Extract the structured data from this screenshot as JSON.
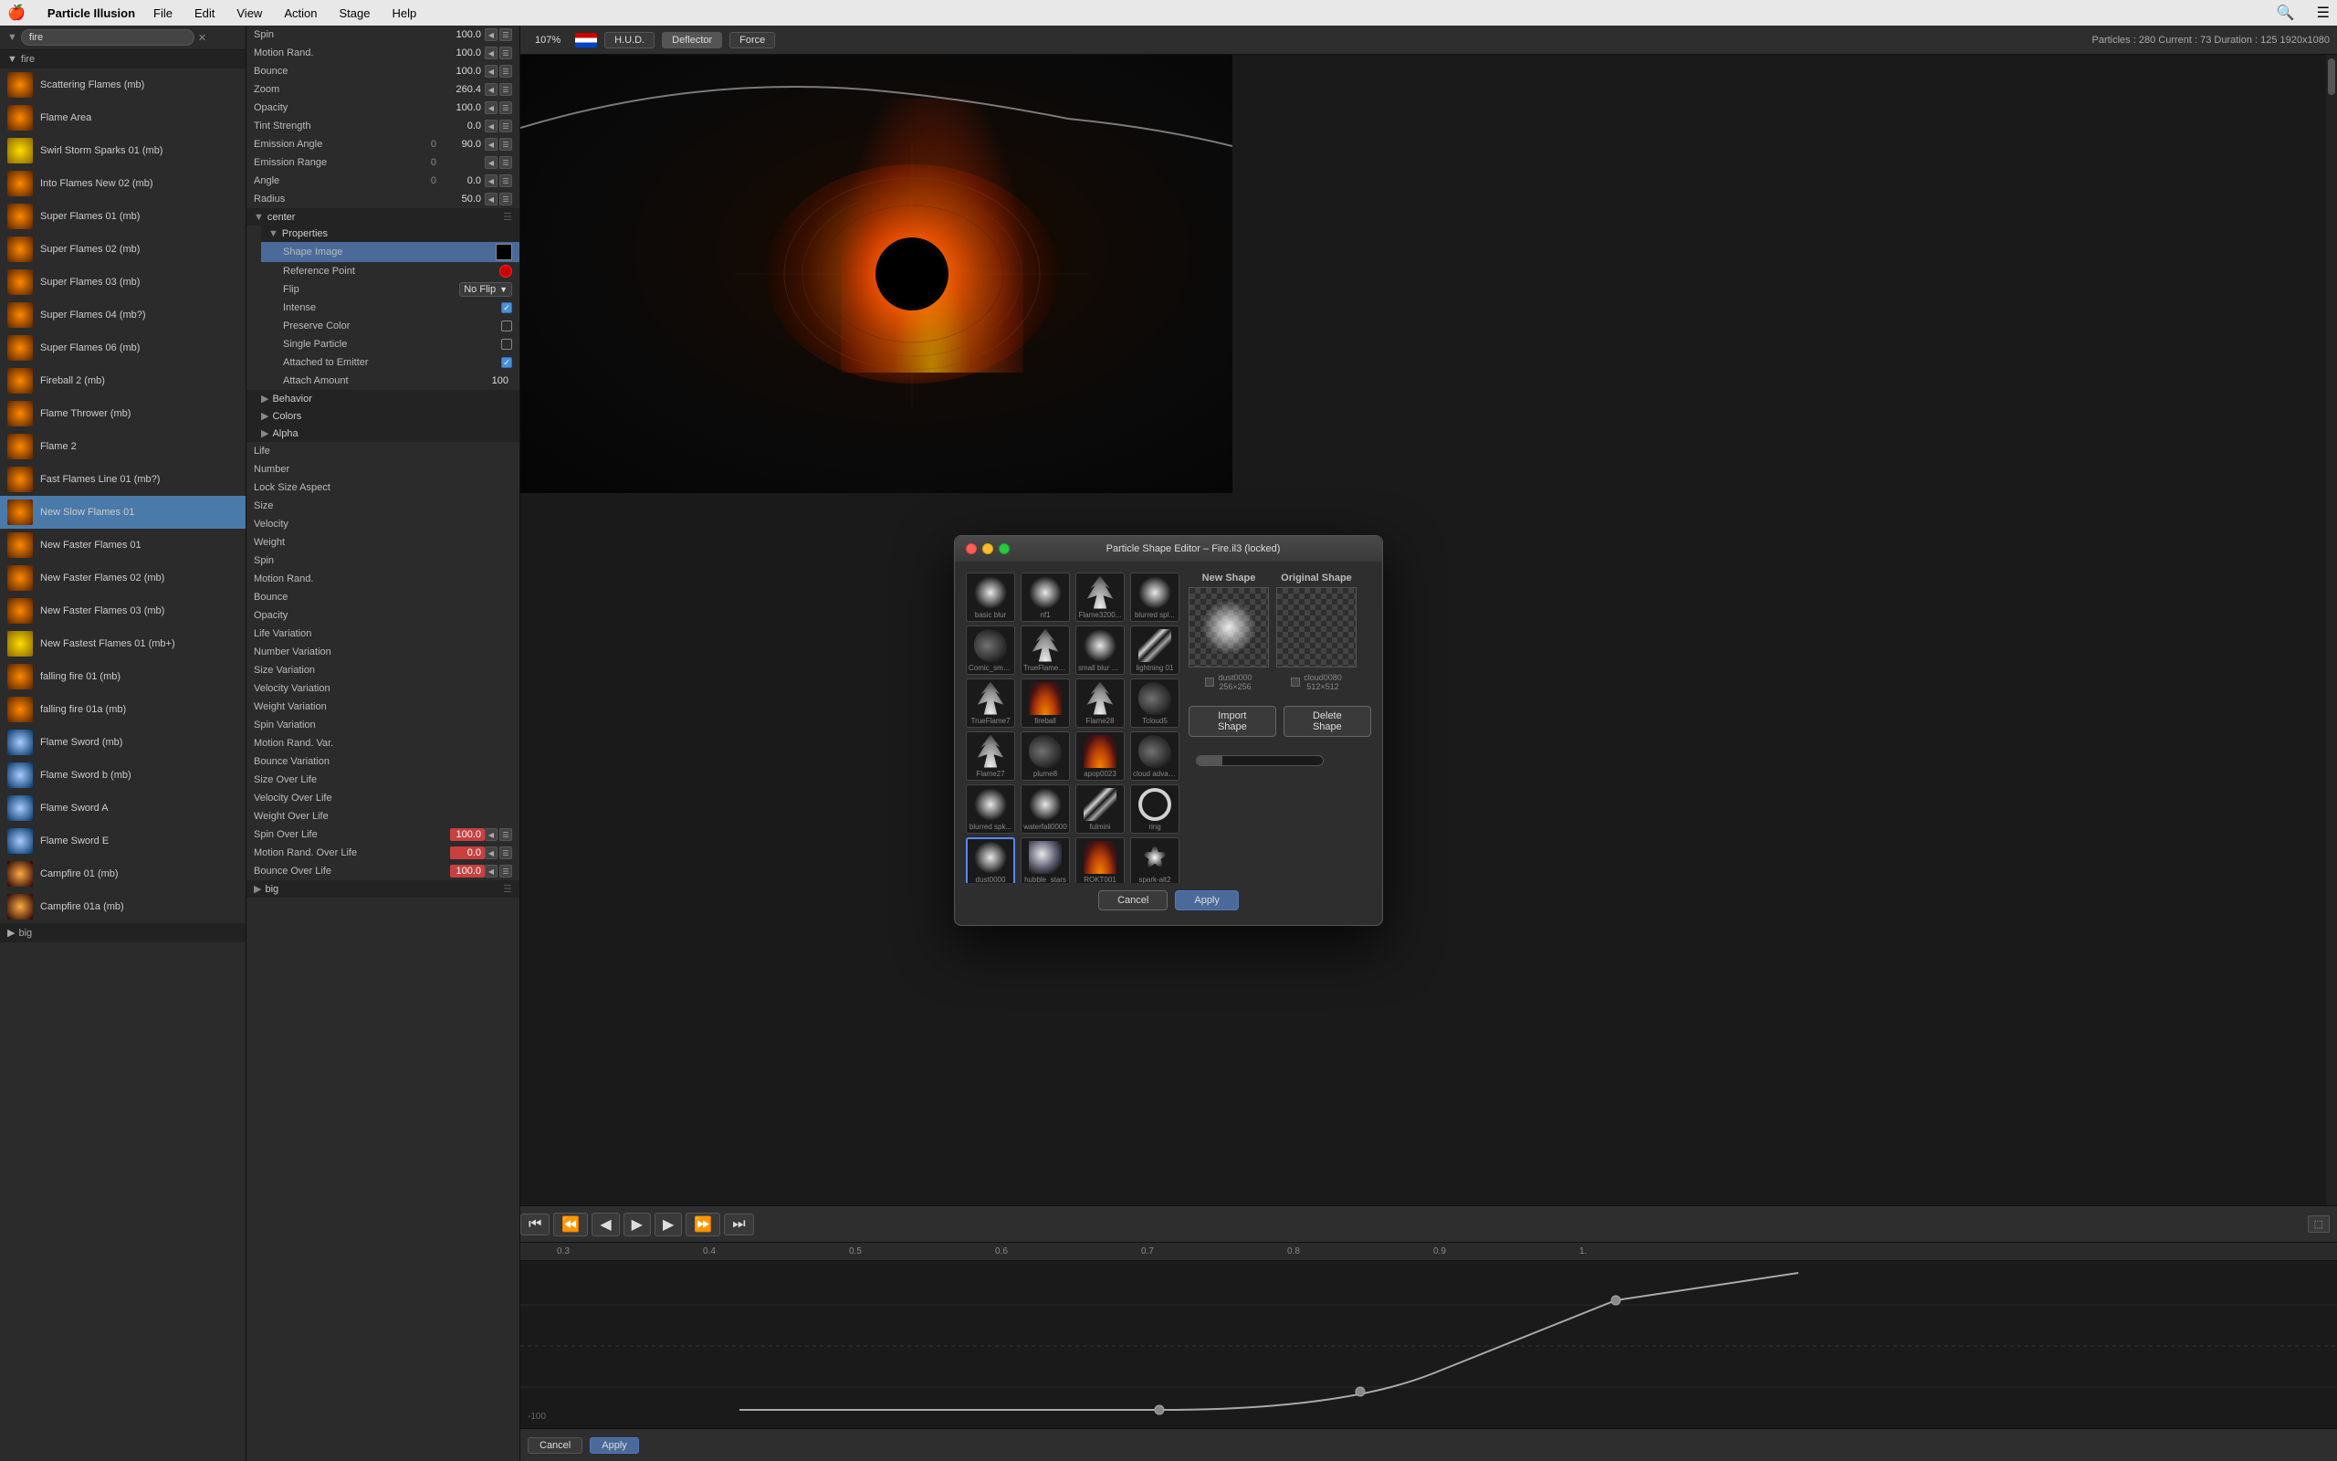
{
  "app": {
    "title": "Particle Illusion",
    "menubar": {
      "apple": "🍎",
      "app_name": "Particle Illusion",
      "menus": [
        "File",
        "Edit",
        "View",
        "Action",
        "Stage",
        "Help"
      ]
    }
  },
  "toolbar": {
    "zoom": "107%",
    "hud_label": "H.U.D.",
    "deflector_label": "Deflector",
    "force_label": "Force",
    "stats": "Particles : 280   Current : 73   Duration : 125   1920x1080"
  },
  "left_panel": {
    "search_placeholder": "fire",
    "items": [
      {
        "name": "Scattering Flames (mb)",
        "thumb": "orange"
      },
      {
        "name": "Flame Area",
        "thumb": "orange"
      },
      {
        "name": "Swirl Storm Sparks 01 (mb)",
        "thumb": "yellow"
      },
      {
        "name": "Into Flames New 02 (mb)",
        "thumb": "orange"
      },
      {
        "name": "Super Flames 01 (mb)",
        "thumb": "orange"
      },
      {
        "name": "Super Flames 02 (mb)",
        "thumb": "orange"
      },
      {
        "name": "Super Flames 03 (mb)",
        "thumb": "orange"
      },
      {
        "name": "Super Flames 04 (mb?)",
        "thumb": "orange"
      },
      {
        "name": "Super Flames 06 (mb)",
        "thumb": "orange"
      },
      {
        "name": "Fireball 2 (mb)",
        "thumb": "orange"
      },
      {
        "name": "Flame Thrower (mb)",
        "thumb": "orange"
      },
      {
        "name": "Flame 2",
        "thumb": "orange"
      },
      {
        "name": "Fast Flames Line 01 (mb?)",
        "thumb": "orange"
      },
      {
        "name": "New Slow Flames 01",
        "thumb": "orange",
        "selected": true
      },
      {
        "name": "New Faster Flames 01",
        "thumb": "orange"
      },
      {
        "name": "New Faster Flames 02 (mb)",
        "thumb": "orange"
      },
      {
        "name": "New Faster Flames 03 (mb)",
        "thumb": "orange"
      },
      {
        "name": "New Fastest Flames 01 (mb+)",
        "thumb": "yellow"
      },
      {
        "name": "falling fire 01 (mb)",
        "thumb": "orange"
      },
      {
        "name": "falling fire 01a (mb)",
        "thumb": "orange"
      },
      {
        "name": "Flame Sword (mb)",
        "thumb": "sword"
      },
      {
        "name": "Flame Sword b (mb)",
        "thumb": "sword"
      },
      {
        "name": "Flame Sword A",
        "thumb": "sword"
      },
      {
        "name": "Flame Sword E",
        "thumb": "sword"
      },
      {
        "name": "Campfire 01 (mb)",
        "thumb": "camp"
      },
      {
        "name": "Campfire 01a (mb)",
        "thumb": "camp"
      }
    ],
    "groups": [
      {
        "name": "fire",
        "expanded": true
      },
      {
        "name": "big",
        "expanded": false
      }
    ]
  },
  "properties": {
    "params": [
      {
        "label": "Spin",
        "value": "100.0"
      },
      {
        "label": "Motion Rand.",
        "value": "100.0"
      },
      {
        "label": "Bounce",
        "value": "100.0"
      },
      {
        "label": "Zoom",
        "value": "260.4"
      },
      {
        "label": "Opacity",
        "value": "100.0"
      },
      {
        "label": "Tint Strength",
        "value": "0.0"
      },
      {
        "label": "Emission Angle",
        "value": "0",
        "value2": "90.0"
      },
      {
        "label": "Emission Range",
        "value": "0",
        "value2": ""
      },
      {
        "label": "Angle",
        "value": "0",
        "value2": "0.0"
      },
      {
        "label": "Radius",
        "value": "",
        "value2": "50.0"
      }
    ],
    "groups": [
      {
        "name": "center",
        "expanded": true,
        "children": [
          {
            "name": "Properties",
            "expanded": true,
            "items": [
              {
                "label": "Shape Image",
                "type": "image",
                "selected": true
              },
              {
                "label": "Reference Point",
                "type": "ref_point"
              },
              {
                "label": "Flip",
                "type": "dropdown",
                "value": "No Flip"
              },
              {
                "label": "Intense",
                "type": "checkbox",
                "checked": true
              },
              {
                "label": "Preserve Color",
                "type": "checkbox",
                "checked": false
              },
              {
                "label": "Single Particle",
                "type": "checkbox",
                "checked": false
              },
              {
                "label": "Attached to Emitter",
                "type": "checkbox",
                "checked": true
              },
              {
                "label": "Attach Amount",
                "type": "value",
                "value": "100"
              }
            ]
          },
          {
            "name": "Behavior",
            "expanded": false
          },
          {
            "name": "Colors",
            "expanded": false
          },
          {
            "name": "Alpha",
            "expanded": false
          }
        ]
      }
    ],
    "bottom_params": [
      {
        "label": "Life"
      },
      {
        "label": "Number"
      },
      {
        "label": "Lock Size Aspect"
      },
      {
        "label": "Size"
      },
      {
        "label": "Velocity"
      },
      {
        "label": "Weight"
      },
      {
        "label": "Spin"
      },
      {
        "label": "Motion Rand."
      },
      {
        "label": "Bounce"
      },
      {
        "label": "Opacity"
      },
      {
        "label": "Life Variation"
      },
      {
        "label": "Number Variation"
      },
      {
        "label": "Size Variation"
      },
      {
        "label": "Velocity Variation"
      },
      {
        "label": "Weight Variation"
      },
      {
        "label": "Spin Variation"
      },
      {
        "label": "Motion Rand. Var."
      },
      {
        "label": "Bounce Variation"
      },
      {
        "label": "Size Over Life"
      },
      {
        "label": "Velocity Over Life"
      },
      {
        "label": "Weight Over Life"
      },
      {
        "label": "Spin Over Life",
        "value": "100.0"
      },
      {
        "label": "Motion Rand. Over Life",
        "value": "0.0"
      },
      {
        "label": "Bounce Over Life",
        "value": "100.0"
      }
    ]
  },
  "shape_editor": {
    "title": "Particle Shape Editor – Fire.il3 (locked)",
    "shapes": [
      {
        "name": "basic blur",
        "style": "sv-blur"
      },
      {
        "name": "nf1",
        "style": "sv-blur"
      },
      {
        "name": "Flame3200...",
        "style": "sv-flame"
      },
      {
        "name": "blurred spl...",
        "style": "sv-blur"
      },
      {
        "name": "Comic_smo...",
        "style": "sv-smoke"
      },
      {
        "name": "TrueFlame5X",
        "style": "sv-flame"
      },
      {
        "name": "small blur st...",
        "style": "sv-blur"
      },
      {
        "name": "lightning 01",
        "style": "sv-lightning"
      },
      {
        "name": "TrueFlame7",
        "style": "sv-flame"
      },
      {
        "name": "fireball",
        "style": "sv-fire-orange"
      },
      {
        "name": "Flame28",
        "style": "sv-flame"
      },
      {
        "name": "Tcloud5",
        "style": "sv-smoke"
      },
      {
        "name": "Flame27",
        "style": "sv-flame"
      },
      {
        "name": "plume8",
        "style": "sv-smoke"
      },
      {
        "name": "apop0023",
        "style": "sv-fire-orange"
      },
      {
        "name": "cloud advan...",
        "style": "sv-smoke"
      },
      {
        "name": "blurred spk...",
        "style": "sv-blur"
      },
      {
        "name": "waterfall0000",
        "style": "sv-blur"
      },
      {
        "name": "fulmini",
        "style": "sv-lightning"
      },
      {
        "name": "ring",
        "style": "sv-ring"
      },
      {
        "name": "dust0000",
        "style": "sv-blur",
        "selected": true
      },
      {
        "name": "hubble_stars",
        "style": "sv-hubble"
      },
      {
        "name": "ROKT001",
        "style": "sv-fire-orange"
      },
      {
        "name": "spark-alt2",
        "style": "sv-star"
      }
    ],
    "new_shape_label": "New Shape",
    "original_shape_label": "Original Shape",
    "new_shape_info": "dust0000\n256×256",
    "original_shape_info": "cloud0080\n512×512",
    "import_btn": "Import Shape",
    "delete_btn": "Delete Shape",
    "cancel_btn": "Cancel",
    "apply_btn": "Apply"
  },
  "timeline": {
    "ruler_marks": [
      "0.3",
      "0.4",
      "0.5",
      "0.6",
      "0.7",
      "0.8",
      "0.9",
      "1."
    ],
    "controls": [
      "⏮",
      "⏪",
      "◀",
      "▶",
      "▶",
      "⏩",
      "⏭"
    ]
  },
  "bottom_bar": {
    "cancel_label": "Cancel",
    "apply_label": "Apply"
  }
}
